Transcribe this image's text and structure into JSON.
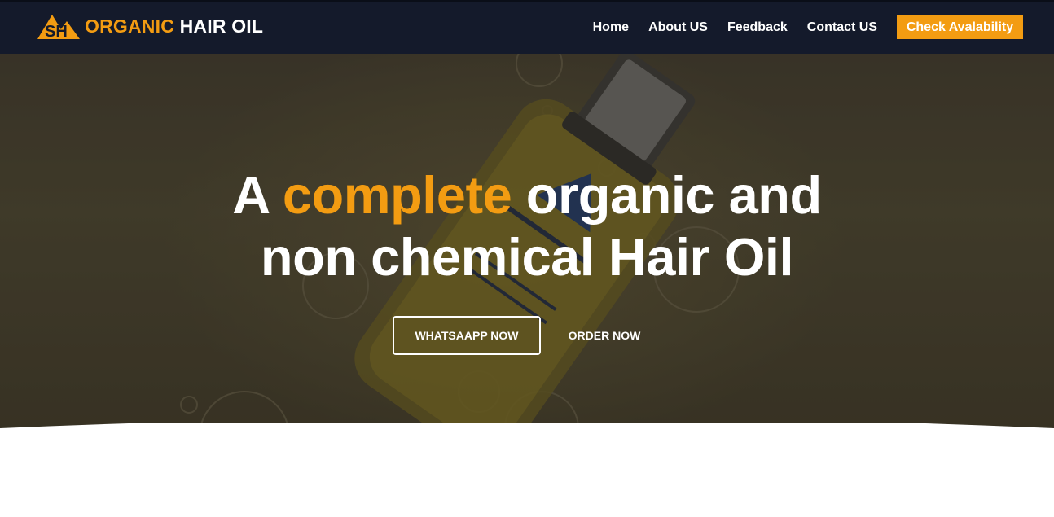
{
  "brand": {
    "logo_icon": "sh-mountain-logo-icon",
    "name_accent": "ORGANIC",
    "name_rest": " HAIR OIL",
    "accent_color": "#f39c12"
  },
  "nav": {
    "items": [
      {
        "label": "Home"
      },
      {
        "label": "About US"
      },
      {
        "label": "Feedback"
      },
      {
        "label": "Contact US"
      }
    ],
    "cta_label": "Check Avalability"
  },
  "hero": {
    "headline_pre": "A ",
    "headline_accent": "complete",
    "headline_mid": " organic and",
    "headline_line2": "non chemical Hair Oil",
    "primary_button": "WHATSAAPP NOW",
    "secondary_button": "ORDER NOW",
    "image": "hair-oil-bottle-image"
  },
  "colors": {
    "navbar": "#141a2b",
    "accent": "#f39c12"
  }
}
